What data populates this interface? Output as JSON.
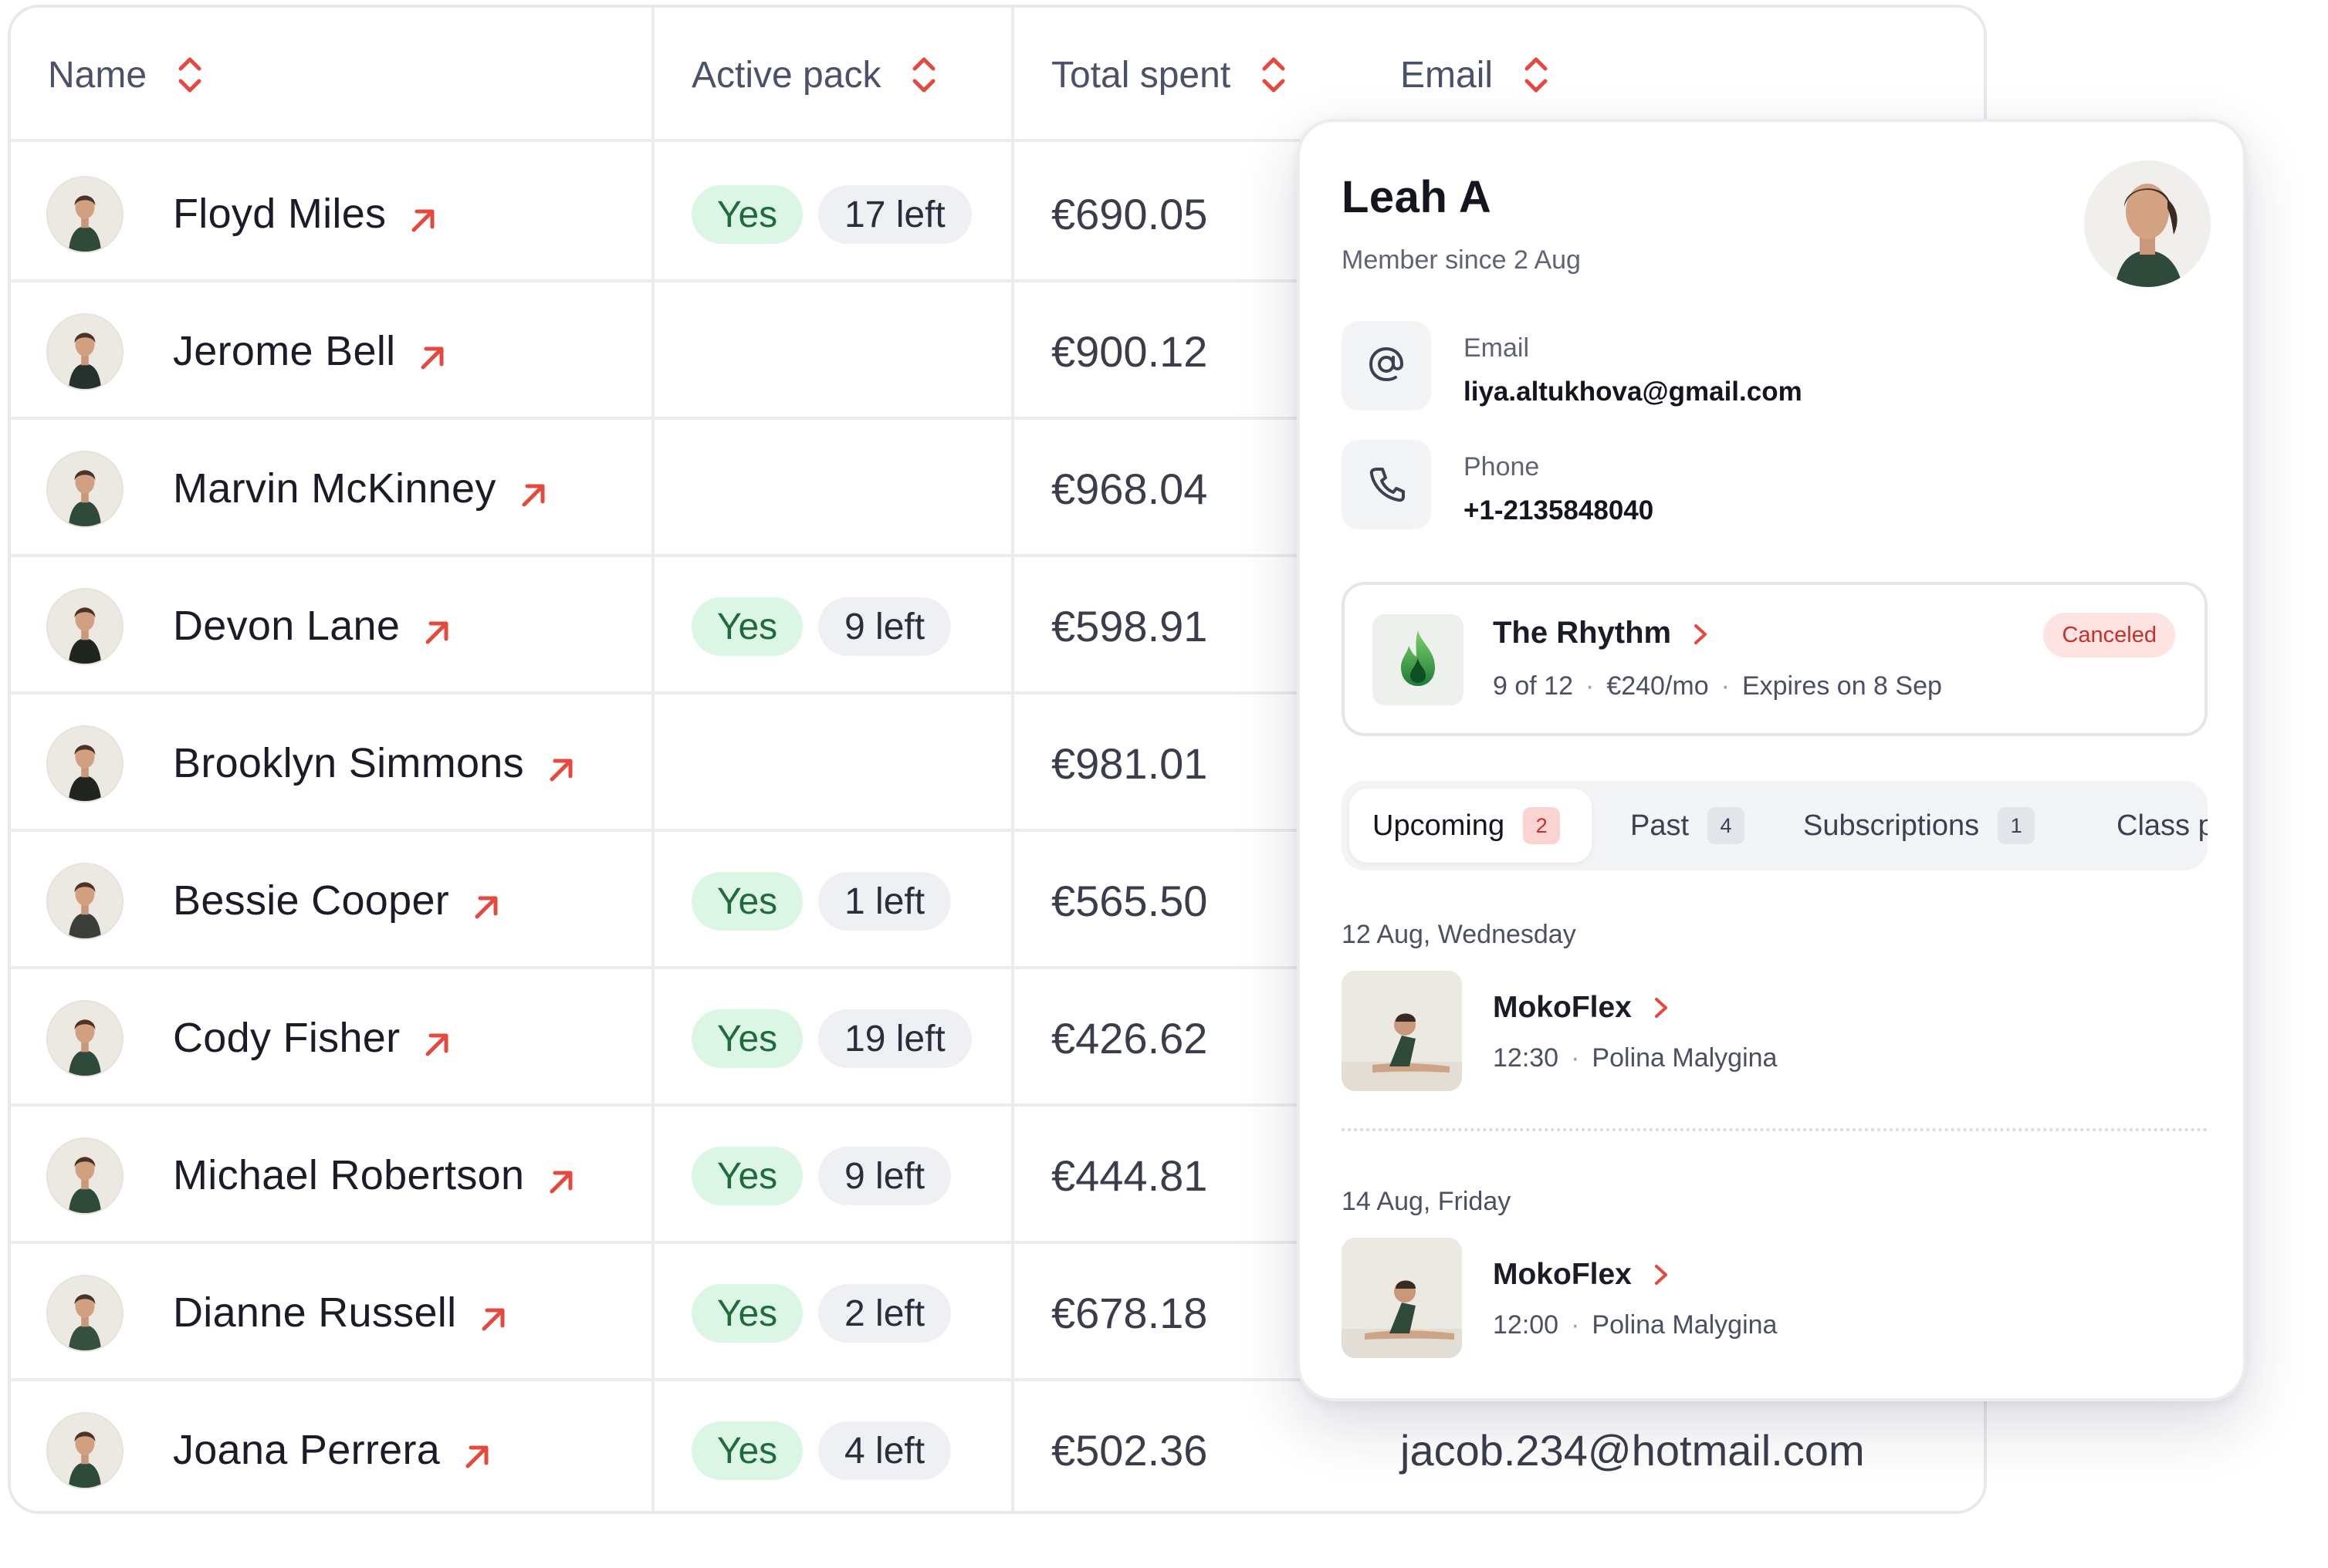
{
  "table": {
    "headers": {
      "name": "Name",
      "active_pack": "Active pack",
      "total_spent": "Total spent",
      "email": "Email"
    },
    "rows": [
      {
        "name": "Floyd Miles",
        "active": "Yes",
        "left": "17 left",
        "spent": "€690.05",
        "email": ""
      },
      {
        "name": "Jerome Bell",
        "active": "",
        "left": "",
        "spent": "€900.12",
        "email": ""
      },
      {
        "name": "Marvin McKinney",
        "active": "",
        "left": "",
        "spent": "€968.04",
        "email": ""
      },
      {
        "name": "Devon Lane",
        "active": "Yes",
        "left": "9 left",
        "spent": "€598.91",
        "email": ""
      },
      {
        "name": "Brooklyn Simmons",
        "active": "",
        "left": "",
        "spent": "€981.01",
        "email": ""
      },
      {
        "name": "Bessie Cooper",
        "active": "Yes",
        "left": "1 left",
        "spent": "€565.50",
        "email": ""
      },
      {
        "name": "Cody Fisher",
        "active": "Yes",
        "left": "19 left",
        "spent": "€426.62",
        "email": ""
      },
      {
        "name": "Michael Robertson",
        "active": "Yes",
        "left": "9 left",
        "spent": "€444.81",
        "email": ""
      },
      {
        "name": "Dianne Russell",
        "active": "Yes",
        "left": "2 left",
        "spent": "€678.18",
        "email": ""
      },
      {
        "name": "Joana Perrera",
        "active": "Yes",
        "left": "4 left",
        "spent": "€502.36",
        "email": "jacob.234@hotmail.com"
      }
    ]
  },
  "profile": {
    "name": "Leah A",
    "member_since": "Member since 2 Aug",
    "email_label": "Email",
    "email_value": "liya.altukhova@gmail.com",
    "phone_label": "Phone",
    "phone_value": "+1-2135848040",
    "subscription": {
      "title": "The Rhythm",
      "status": "Canceled",
      "progress": "9 of 12",
      "price": "€240/mo",
      "expires": "Expires on 8 Sep"
    },
    "tabs": [
      {
        "label": "Upcoming",
        "count": "2"
      },
      {
        "label": "Past",
        "count": "4"
      },
      {
        "label": "Subscriptions",
        "count": "1"
      },
      {
        "label": "Class p",
        "count": ""
      }
    ],
    "schedule": [
      {
        "day": "12 Aug, Wednesday",
        "title": "MokoFlex",
        "time": "12:30",
        "instructor": "Polina Malygina"
      },
      {
        "day": "14 Aug, Friday",
        "title": "MokoFlex",
        "time": "12:00",
        "instructor": "Polina Malygina"
      }
    ]
  },
  "colors": {
    "accent_red": "#e5483d",
    "yes_bg": "#dcf6e6",
    "yes_text": "#1f6b3e",
    "canceled_bg": "#fde3e1",
    "canceled_text": "#c8312a",
    "border": "#ececf0"
  },
  "icons": {
    "sort": "sort-arrows-icon",
    "row_link": "arrow-up-right-icon",
    "email": "at-sign-icon",
    "phone": "phone-icon",
    "subscription": "flame-icon",
    "open": "chevron-right-icon"
  }
}
